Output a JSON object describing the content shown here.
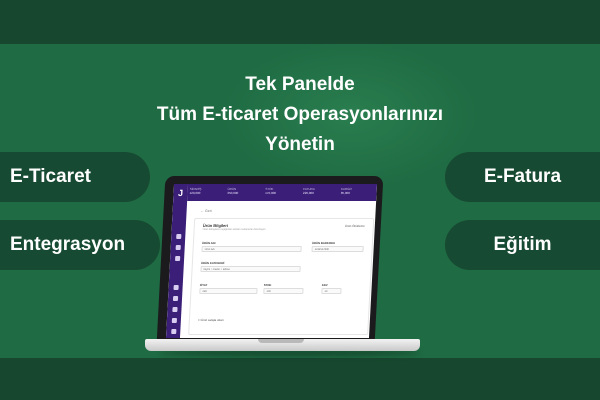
{
  "headline": {
    "line1": "Tek Panelde",
    "line2": "Tüm E-ticaret Operasyonlarınızı",
    "line3": "Yönetin"
  },
  "features": {
    "left": [
      "E-Ticaret",
      "Entegrasyon"
    ],
    "right": [
      "E-Fatura",
      "Eğitim"
    ]
  },
  "app": {
    "logo": "J",
    "stats": [
      {
        "key": "SİPARİŞ",
        "value": "120,000"
      },
      {
        "key": "ÜRÜN",
        "value": "350,000"
      },
      {
        "key": "STOK",
        "value": "170,000"
      },
      {
        "key": "FATURA",
        "value": "220,000"
      },
      {
        "key": "KARGO",
        "value": "85,000"
      }
    ],
    "back_label": "← Geri",
    "card_title": "Ürün Bilgileri",
    "card_sub": "Ürün detaylarını aşağıdaki alanları kullanarak düzenleyin",
    "card_link": "Ürün Önizleme",
    "fields": {
      "name_label": "ÜRÜN ADI",
      "name_value": "Ürün Adı",
      "barcode_label": "ÜRÜN BARKODU",
      "barcode_value": "1234567890",
      "cat_label": "ÜRÜN KATEGORİ",
      "cat_value": "Giyim > Kadın > Elbise",
      "price_label": "FİYAT",
      "price_value": "249",
      "stock_label": "STOK",
      "stock_value": "100",
      "vat_label": "KDV",
      "vat_value": "10"
    },
    "checkbox_label": "Ürün satışta olsun"
  }
}
